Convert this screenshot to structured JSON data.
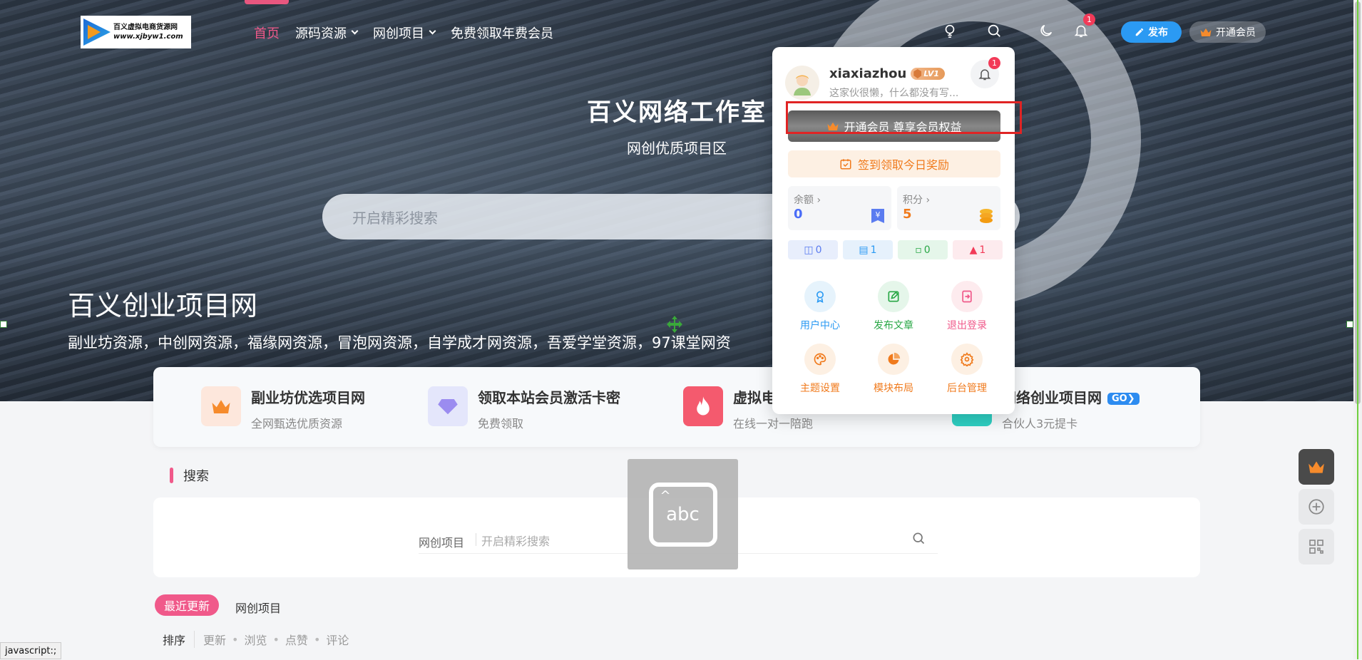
{
  "logo": {
    "line1": "百义虚拟电商货源网",
    "line2": "www.xjbyw1.com"
  },
  "nav": {
    "items": [
      {
        "label": "首页",
        "active": true,
        "dropdown": false
      },
      {
        "label": "源码资源",
        "active": false,
        "dropdown": true
      },
      {
        "label": "网创项目",
        "active": false,
        "dropdown": true
      },
      {
        "label": "免费领取年费会员",
        "active": false,
        "dropdown": false
      }
    ],
    "icons": [
      "lightbulb-icon",
      "search-icon",
      "moon-icon",
      "bell-icon"
    ],
    "bell_badge": "1",
    "publish_label": "发布",
    "vip_label": "开通会员"
  },
  "hero": {
    "title": "百义网络工作室",
    "subtitle": "网创优质项目区",
    "search_placeholder": "开启精彩搜索",
    "heading": "百义创业项目网",
    "description": "副业坊资源，中创网资源，福缘网资源，冒泡网资源，自学成才网资源，吾爱学堂资源，97课堂网资"
  },
  "features": [
    {
      "title": "副业坊优选项目网",
      "desc": "全网甄选优质资源",
      "icon": "crown-icon"
    },
    {
      "title": "领取本站会员激活卡密",
      "desc": "免费领取",
      "icon": "diamond-icon"
    },
    {
      "title": "虚拟电",
      "desc": "在线一对一陪跑",
      "icon": "fire-icon"
    },
    {
      "title": "网络创业项目网",
      "desc": "合伙人3元提卡",
      "icon": "link-icon",
      "badge": "GO"
    }
  ],
  "search_section": {
    "title": "搜索",
    "category": "网创项目",
    "placeholder": "开启精彩搜索"
  },
  "keyboard_overlay": {
    "text": "abc"
  },
  "tabs": {
    "recent": "最近更新",
    "projects": "网创项目"
  },
  "sort": {
    "lead": "排序",
    "options": [
      "更新",
      "浏览",
      "点赞",
      "评论"
    ]
  },
  "status_bar": "javascript:;",
  "user_menu": {
    "username": "xiaxiazhou",
    "level": "LV1",
    "signature": "这家伙很懒，什么都没有写...",
    "bell_badge": "1",
    "vip_banner": "开通会员 尊享会员权益",
    "checkin": "签到领取今日奖励",
    "balance": {
      "label": "余额",
      "value": "0"
    },
    "points": {
      "label": "积分",
      "value": "5"
    },
    "counts": [
      {
        "icon": "comment-icon",
        "value": "0"
      },
      {
        "icon": "article-icon",
        "value": "1"
      },
      {
        "icon": "message-icon",
        "value": "0"
      },
      {
        "icon": "fire-icon",
        "value": "1"
      }
    ],
    "actions": [
      {
        "label": "用户中心",
        "icon": "user-center-icon"
      },
      {
        "label": "发布文章",
        "icon": "edit-icon"
      },
      {
        "label": "退出登录",
        "icon": "logout-icon"
      },
      {
        "label": "主题设置",
        "icon": "palette-icon"
      },
      {
        "label": "模块布局",
        "icon": "pie-chart-icon"
      },
      {
        "label": "后台管理",
        "icon": "gear-icon"
      }
    ]
  },
  "floating_buttons": [
    "crown-icon",
    "plus-icon",
    "qrcode-icon"
  ],
  "colors": {
    "accent": "#f0598a",
    "primary": "#2b9af3",
    "orange": "#f07a1c"
  }
}
